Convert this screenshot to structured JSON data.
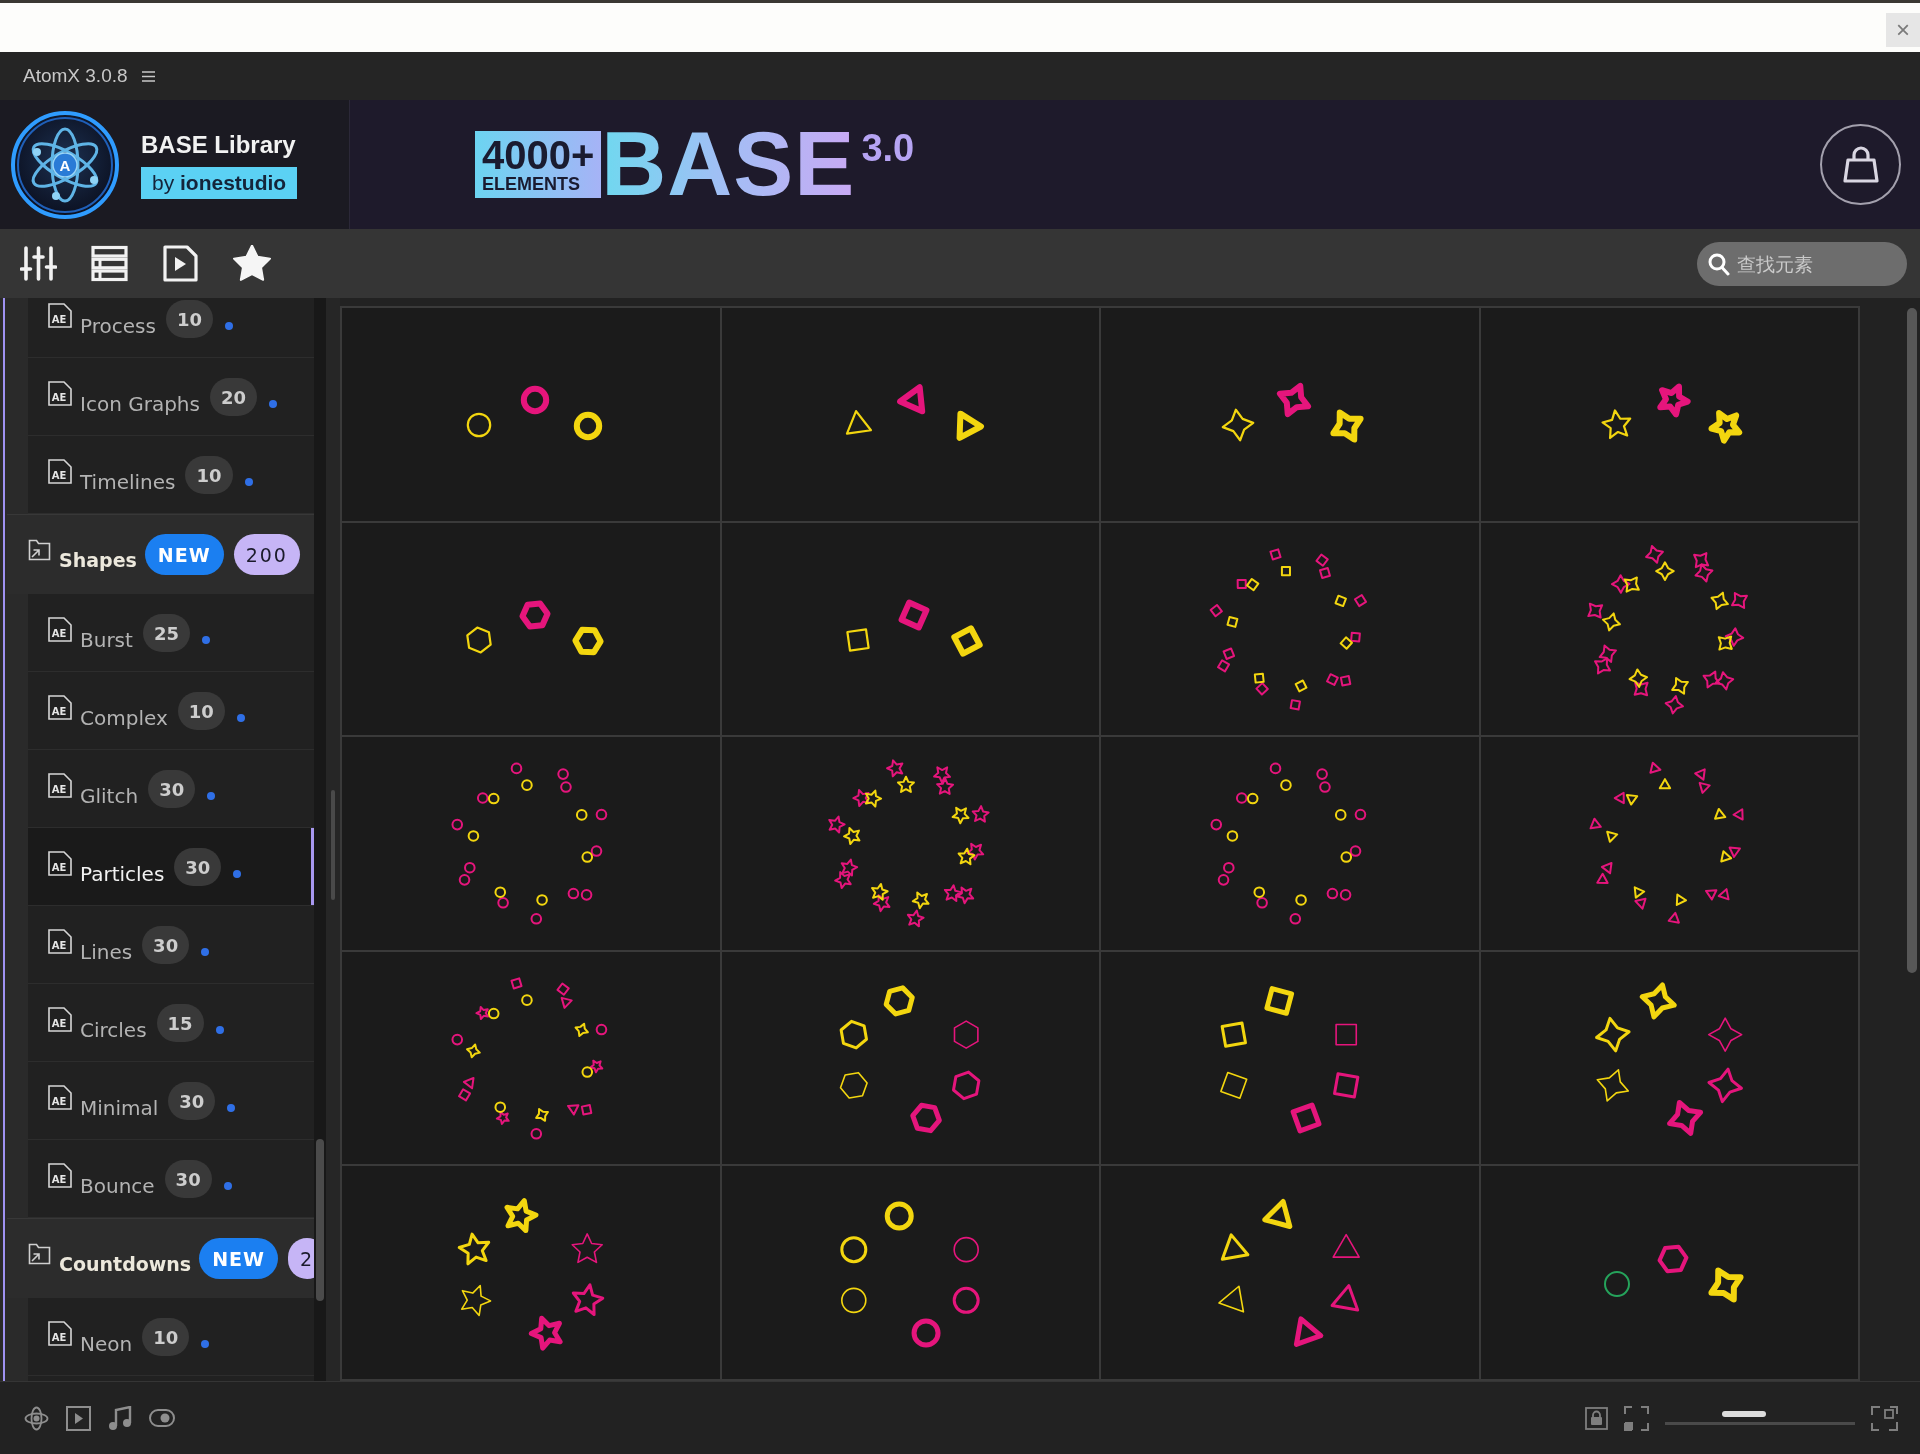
{
  "top_strip": {
    "close_label": "×"
  },
  "title_bar": {
    "app_name": "AtomX 3.0.8"
  },
  "banner": {
    "logo_letter": "A",
    "library_name": "BASE Library",
    "author": "by **ionestudio**",
    "promo": {
      "count": "4000+",
      "unit": "ELEMENTS",
      "word": "BASE",
      "version": "3.0"
    }
  },
  "toolbar": {
    "search": {
      "placeholder": "查找元素"
    }
  },
  "sidebar": {
    "categories": [
      {
        "children": [
          {
            "label": "Process",
            "count": "10",
            "file_tag": "AE",
            "selected": false
          },
          {
            "label": "Icon Graphs",
            "count": "20",
            "file_tag": "AE",
            "selected": false
          },
          {
            "label": "Timelines",
            "count": "10",
            "file_tag": "AE",
            "selected": false
          }
        ]
      },
      {
        "label": "Shapes",
        "tag": "NEW",
        "count": "200",
        "children": [
          {
            "label": "Burst",
            "count": "25",
            "file_tag": "AE",
            "selected": false
          },
          {
            "label": "Complex",
            "count": "10",
            "file_tag": "AE",
            "selected": false
          },
          {
            "label": "Glitch",
            "count": "30",
            "file_tag": "AE",
            "selected": false
          },
          {
            "label": "Particles",
            "count": "30",
            "file_tag": "AE",
            "selected": true
          },
          {
            "label": "Lines",
            "count": "30",
            "file_tag": "AE",
            "selected": false
          },
          {
            "label": "Circles",
            "count": "15",
            "file_tag": "AE",
            "selected": false
          },
          {
            "label": "Minimal",
            "count": "30",
            "file_tag": "AE",
            "selected": false
          },
          {
            "label": "Bounce",
            "count": "30",
            "file_tag": "AE",
            "selected": false
          }
        ]
      },
      {
        "label": "Countdowns",
        "tag": "NEW",
        "count": "2",
        "children": [
          {
            "label": "Neon",
            "count": "10",
            "file_tag": "AE",
            "selected": false
          }
        ]
      }
    ]
  },
  "grid": {
    "tiles": [
      {
        "kind": "circle-trio"
      },
      {
        "kind": "triangle-trio"
      },
      {
        "kind": "sparkle-trio"
      },
      {
        "kind": "star-trio"
      },
      {
        "kind": "hexagon-trio"
      },
      {
        "kind": "square-trio"
      },
      {
        "kind": "square-burst"
      },
      {
        "kind": "sparkle-burst"
      },
      {
        "kind": "circle-burst"
      },
      {
        "kind": "star-burst"
      },
      {
        "kind": "circle-burst"
      },
      {
        "kind": "triangle-burst"
      },
      {
        "kind": "mixed-burst"
      },
      {
        "kind": "hexagon-ring"
      },
      {
        "kind": "square-ring"
      },
      {
        "kind": "sparkle-ring"
      },
      {
        "kind": "star-ring"
      },
      {
        "kind": "circle-ring"
      },
      {
        "kind": "triangle-ring"
      },
      {
        "kind": "mixed-trio"
      }
    ]
  },
  "bottom_bar": {
    "zoom": {
      "level": 0.39
    }
  }
}
